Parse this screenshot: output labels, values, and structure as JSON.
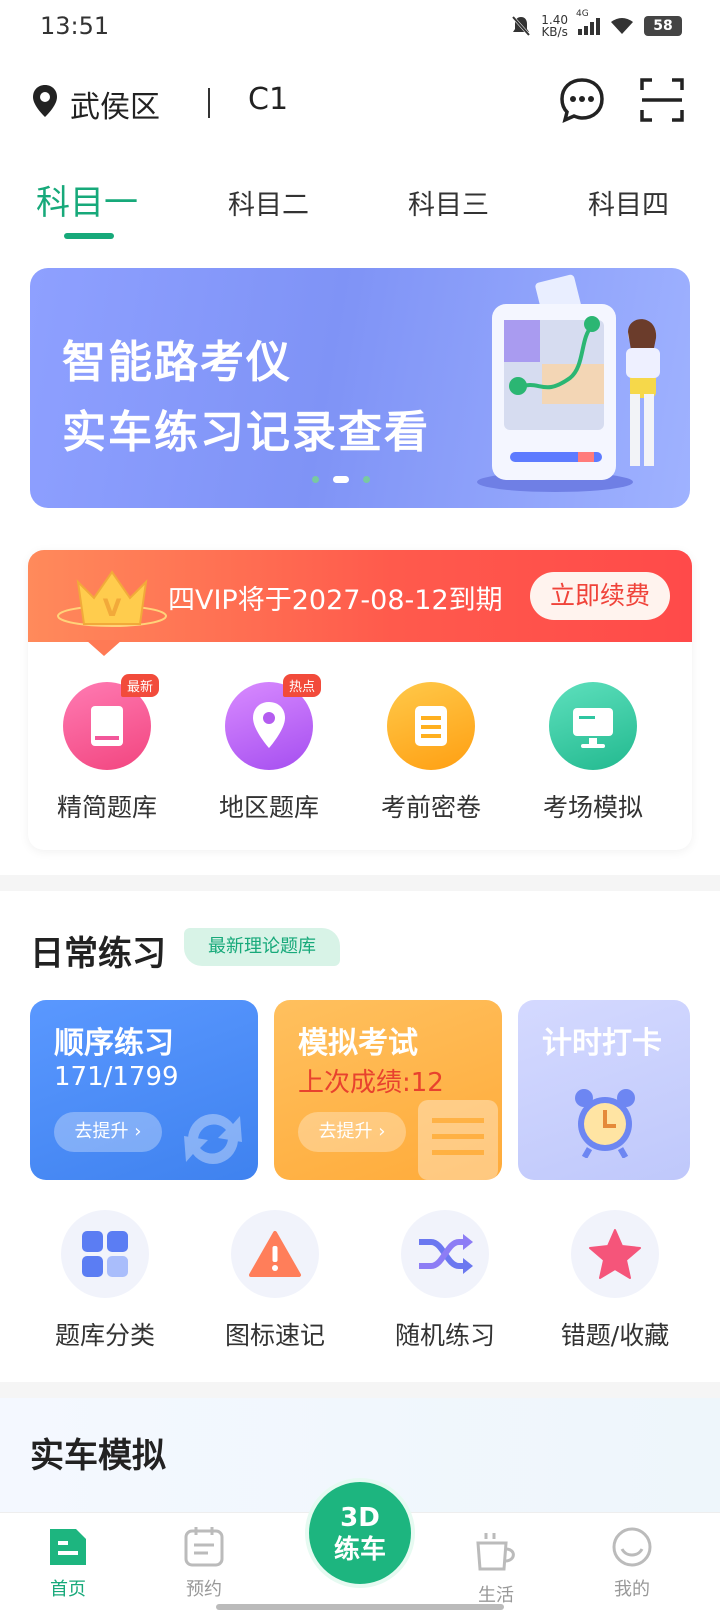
{
  "status_bar": {
    "time": "13:51",
    "speed": "1.40",
    "speed_unit": "KB/s",
    "net": "4G",
    "battery": "58"
  },
  "header": {
    "location": "武侯区",
    "license": "C1"
  },
  "tabs": [
    {
      "label": "科目一"
    },
    {
      "label": "科目二"
    },
    {
      "label": "科目三"
    },
    {
      "label": "科目四"
    }
  ],
  "banner": {
    "line1": "智能路考仪",
    "line2": "实车练习记录查看"
  },
  "vip": {
    "notice": "四VIP将于2027-08-12到期",
    "renew_label": "立即续费"
  },
  "features": [
    {
      "label": "精简题库",
      "badge": "最新",
      "color": "#f2579a"
    },
    {
      "label": "地区题库",
      "badge": "热点",
      "color": "#b45cf0"
    },
    {
      "label": "考前密卷",
      "badge": "",
      "color": "#ffb01f"
    },
    {
      "label": "考场模拟",
      "badge": "",
      "color": "#2fc6a1"
    }
  ],
  "daily": {
    "title": "日常练习",
    "tag": "最新理论题库",
    "cards": [
      {
        "title": "顺序练习",
        "value": "171/1799",
        "action": "去提升",
        "color": "#4d8ff7"
      },
      {
        "title": "模拟考试",
        "value": "上次成绩:12",
        "action": "去提升",
        "color": "#ffb448"
      },
      {
        "title": "计时打卡",
        "color": "#c8cffb"
      }
    ],
    "tools": [
      {
        "label": "题库分类",
        "icon": "grid-icon"
      },
      {
        "label": "图标速记",
        "icon": "warning-icon"
      },
      {
        "label": "随机练习",
        "icon": "shuffle-icon"
      },
      {
        "label": "错题/收藏",
        "icon": "star-icon"
      }
    ]
  },
  "real_sim": {
    "title": "实车模拟"
  },
  "bottom_nav": {
    "home": "首页",
    "booking": "预约",
    "center_line1": "3D",
    "center_line2": "练车",
    "life": "生活",
    "mine": "我的"
  },
  "colors": {
    "brand": "#17a97a",
    "vip_red": "#f0433a"
  }
}
